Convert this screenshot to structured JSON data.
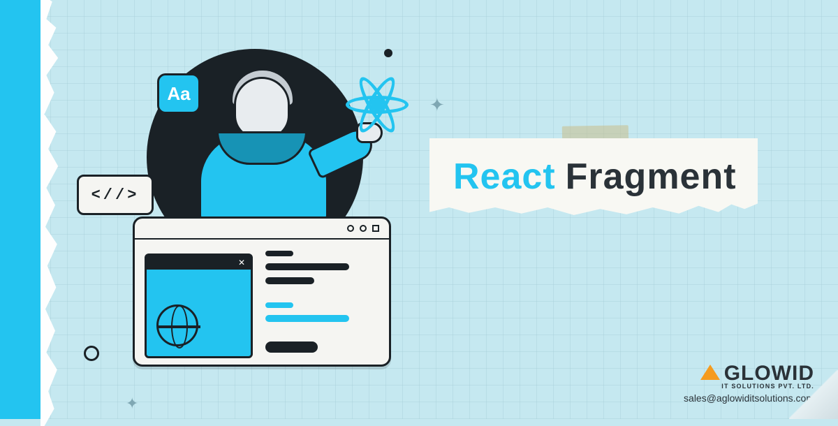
{
  "title": {
    "word1": "React",
    "word2": "Fragment"
  },
  "badges": {
    "aa": "Aa",
    "code": "<//>"
  },
  "popup": {
    "close": "✕"
  },
  "brand": {
    "name": "GLOWID",
    "sub": "IT SOLUTIONS PVT. LTD.",
    "email": "sales@aglowiditsolutions.com"
  },
  "decor": {
    "spark": "✦"
  }
}
